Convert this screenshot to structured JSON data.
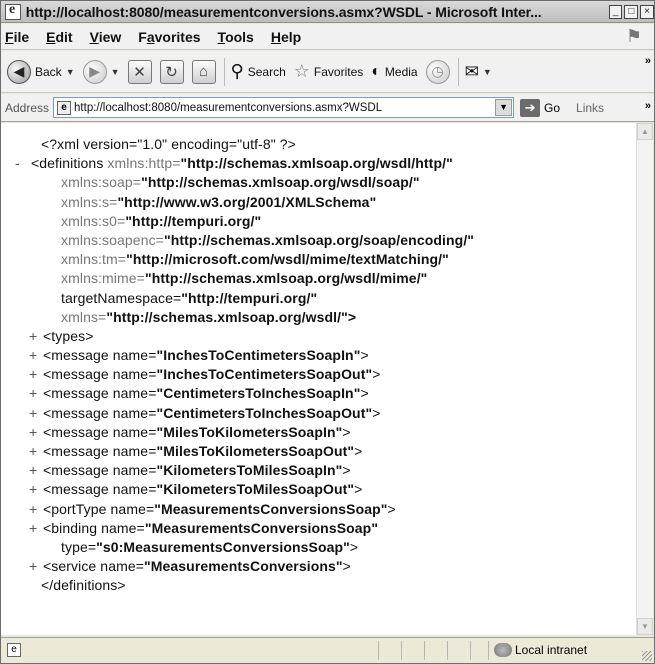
{
  "window": {
    "title": "http://localhost:8080/measurementconversions.asmx?WSDL - Microsoft Inter...",
    "controls": [
      "minimize",
      "maximize",
      "close"
    ]
  },
  "menu": {
    "file": {
      "u": "F",
      "rest": "ile"
    },
    "edit": {
      "u": "E",
      "rest": "dit"
    },
    "view": {
      "u": "V",
      "rest": "iew"
    },
    "favorites": {
      "pre": "F",
      "u": "a",
      "rest": "vorites"
    },
    "tools": {
      "u": "T",
      "rest": "ools"
    },
    "help": {
      "u": "H",
      "rest": "elp"
    }
  },
  "toolbar": {
    "back_label": "Back",
    "search_label": "Search",
    "favorites_label": "Favorites",
    "media_label": "Media",
    "more": "»"
  },
  "address": {
    "label": "Address",
    "url": "http://localhost:8080/measurementconversions.asmx?WSDL",
    "go_label": "Go",
    "links_label": "Links",
    "more": "»"
  },
  "xml": {
    "decl": "<?xml version=\"1.0\" encoding=\"utf-8\" ?>",
    "definitions_open": "<definitions",
    "ns_http_attr": "xmlns:http=",
    "ns_http_val": "\"http://schemas.xmlsoap.org/wsdl/http/\"",
    "ns_soap_attr": "xmlns:soap=",
    "ns_soap_val": "\"http://schemas.xmlsoap.org/wsdl/soap/\"",
    "ns_s_attr": "xmlns:s=",
    "ns_s_val": "\"http://www.w3.org/2001/XMLSchema\"",
    "ns_s0_attr": "xmlns:s0=",
    "ns_s0_val": "\"http://tempuri.org/\"",
    "ns_soapenc_attr": "xmlns:soapenc=",
    "ns_soapenc_val": "\"http://schemas.xmlsoap.org/soap/encoding/\"",
    "ns_tm_attr": "xmlns:tm=",
    "ns_tm_val": "\"http://microsoft.com/wsdl/mime/textMatching/\"",
    "ns_mime_attr": "xmlns:mime=",
    "ns_mime_val": "\"http://schemas.xmlsoap.org/wsdl/mime/\"",
    "tns_attr": "targetNamespace=",
    "tns_val": "\"http://tempuri.org/\"",
    "ns_attr": "xmlns=",
    "ns_val": "\"http://schemas.xmlsoap.org/wsdl/\">",
    "types": "<types>",
    "messages": [
      {
        "pre": "<message name=",
        "val": "\"InchesToCentimetersSoapIn\"",
        "post": ">"
      },
      {
        "pre": "<message name=",
        "val": "\"InchesToCentimetersSoapOut\"",
        "post": ">"
      },
      {
        "pre": "<message name=",
        "val": "\"CentimetersToInchesSoapIn\"",
        "post": ">"
      },
      {
        "pre": "<message name=",
        "val": "\"CentimetersToInchesSoapOut\"",
        "post": ">"
      },
      {
        "pre": "<message name=",
        "val": "\"MilesToKilometersSoapIn\"",
        "post": ">"
      },
      {
        "pre": "<message name=",
        "val": "\"MilesToKilometersSoapOut\"",
        "post": ">"
      },
      {
        "pre": "<message name=",
        "val": "\"KilometersToMilesSoapIn\"",
        "post": ">"
      },
      {
        "pre": "<message name=",
        "val": "\"KilometersToMilesSoapOut\"",
        "post": ">"
      }
    ],
    "porttype_pre": "<portType name=",
    "porttype_val": "\"MeasurementsConversionsSoap\"",
    "binding_pre": "<binding name=",
    "binding_val": "\"MeasurementsConversionsSoap\"",
    "binding_type_pre": "type=",
    "binding_type_val": "\"s0:MeasurementsConversionsSoap\"",
    "service_pre": "<service name=",
    "service_val": "\"MeasurementsConversions\"",
    "close_gt": ">",
    "definitions_close": "</definitions>",
    "plus": "+",
    "minus": "-"
  },
  "status": {
    "zone": "Local intranet"
  }
}
